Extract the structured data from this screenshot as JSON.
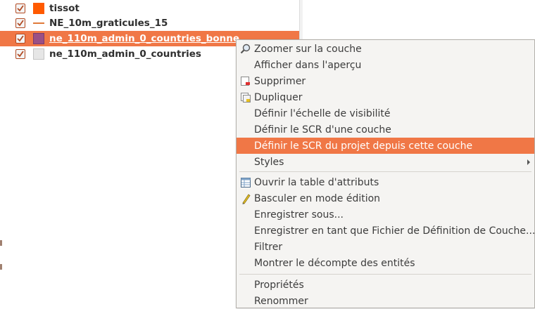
{
  "layers": [
    {
      "name": "tissot",
      "checked": true,
      "symbol": "fill-orange",
      "selected": false
    },
    {
      "name": "NE_10m_graticules_15",
      "checked": true,
      "symbol": "line",
      "selected": false
    },
    {
      "name": "ne_110m_admin_0_countries_bonne",
      "checked": true,
      "symbol": "fill-purple",
      "selected": true
    },
    {
      "name": "ne_110m_admin_0_countries",
      "checked": true,
      "symbol": "fill-grey",
      "selected": false
    }
  ],
  "context_menu": {
    "items": [
      {
        "label": "Zoomer sur la couche",
        "icon": "zoom-icon"
      },
      {
        "label": "Afficher dans l'aperçu",
        "icon": null
      },
      {
        "label": "Supprimer",
        "icon": "remove-layer-icon"
      },
      {
        "label": "Dupliquer",
        "icon": "duplicate-layer-icon"
      },
      {
        "label": "Définir l'échelle de visibilité",
        "icon": null
      },
      {
        "label": "Définir le SCR d'une couche",
        "icon": null
      },
      {
        "label": "Définir le SCR du projet depuis cette couche",
        "icon": null,
        "highlighted": true
      },
      {
        "label": "Styles",
        "icon": null,
        "submenu": true
      },
      {
        "label": "Ouvrir la table d'attributs",
        "icon": "attribute-table-icon"
      },
      {
        "label": "Basculer en mode édition",
        "icon": "pencil-icon"
      },
      {
        "label": "Enregistrer sous...",
        "icon": null
      },
      {
        "label": "Enregistrer en tant que Fichier de Définition de Couche...",
        "icon": null
      },
      {
        "label": "Filtrer",
        "icon": null
      },
      {
        "label": "Montrer le décompte des entités",
        "icon": null
      },
      {
        "label": "Propriétés",
        "icon": null
      },
      {
        "label": "Renommer",
        "icon": null
      }
    ]
  },
  "colors": {
    "selection": "#f07746",
    "menu_background": "#f5f4f2",
    "checkbox_border": "#b24a22"
  }
}
